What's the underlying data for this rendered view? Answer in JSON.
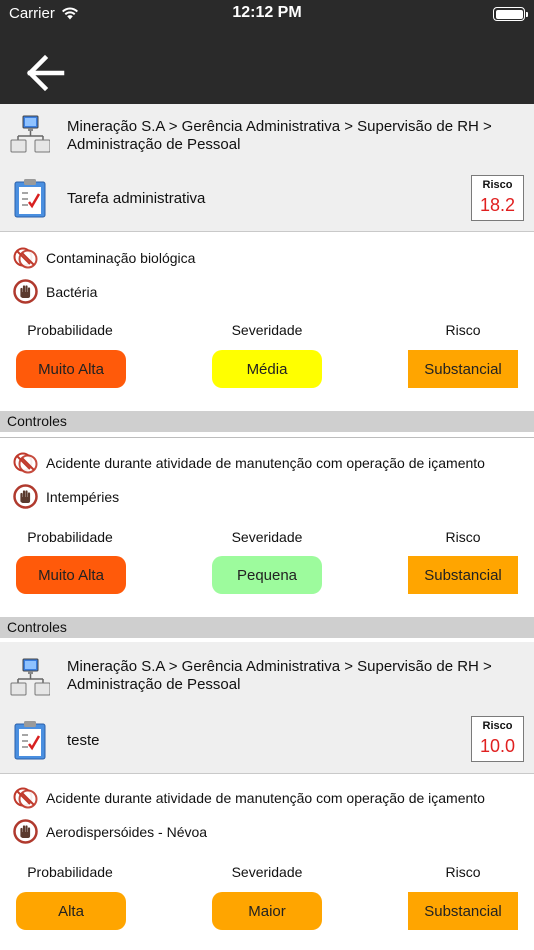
{
  "status_bar": {
    "carrier": "Carrier",
    "time": "12:12 PM"
  },
  "colors": {
    "muito_alta": "#ff5a0a",
    "media": "#ffff00",
    "pequena": "#9dfb9d",
    "alta": "#ffa500",
    "maior": "#ffa500",
    "substancial": "#ffa500",
    "risk_value": "#e02020",
    "bar_bg": "#2a2a2a"
  },
  "column_labels": {
    "probabilidade": "Probabilidade",
    "severidade": "Severidade",
    "risco": "Risco"
  },
  "controls_label": "Controles",
  "groups": [
    {
      "org_path": "Mineração S.A > Gerência Administrativa > Supervisão de RH > Administração de Pessoal",
      "task": "Tarefa administrativa",
      "risk_label": "Risco",
      "risk_value": "18.2",
      "hazards": [
        {
          "hazard": "Contaminação biológica",
          "agent": "Bactéria",
          "probabilidade": "Muito Alta",
          "severidade": "Média",
          "risco": "Substancial"
        },
        {
          "hazard": "Acidente durante atividade de manutenção com operação de içamento",
          "agent": "Intempéries",
          "probabilidade": "Muito Alta",
          "severidade": "Pequena",
          "risco": "Substancial"
        }
      ]
    },
    {
      "org_path": "Mineração S.A > Gerência Administrativa > Supervisão de RH > Administração de Pessoal",
      "task": "teste",
      "risk_label": "Risco",
      "risk_value": "10.0",
      "hazards": [
        {
          "hazard": "Acidente durante atividade de manutenção com operação de içamento",
          "agent": "Aerodispersóides - Névoa",
          "probabilidade": "Alta",
          "severidade": "Maior",
          "risco": "Substancial"
        }
      ]
    }
  ]
}
